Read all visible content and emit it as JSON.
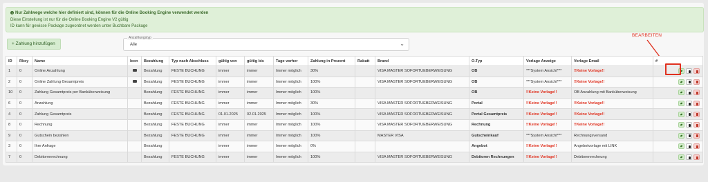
{
  "notice": {
    "line1": "Nur Zahlwege welche hier definiert sind, können für die Online Booking Engine verwendet werden",
    "line2": "Diese Einstellung ist nur für die Online Booking Engine V2 gültig",
    "line3": "ID kann für gewisse Package zugeordnet werden unter Buchbare Package"
  },
  "toolbar": {
    "add_label": "+ Zahlung hinzufügen",
    "select_label": "Anzahlungstyp",
    "select_value": "Alle"
  },
  "annotation": {
    "label": "BEARBEITEN",
    "color": "#e0301e"
  },
  "table": {
    "headers": [
      "ID",
      "Rkey",
      "Name",
      "Icon",
      "Bezahlung",
      "Typ nach Abschluss",
      "gültig von",
      "gültig bis",
      "Tage vorher",
      "Zahlung in Prozent",
      "Rabatt",
      "Brand",
      "O.Typ",
      "Vorlage Anzeige",
      "Vorlage Email",
      "#"
    ],
    "rows": [
      {
        "id": "1",
        "rkey": "0",
        "name": "Online Anzahlung",
        "icon": "bank-icon",
        "bezahlung": "Bezahlung",
        "typ": "FESTE BUCHUNG",
        "von": "immer",
        "bis": "immer",
        "tage": "Immer möglich",
        "prozent": "30%",
        "rabatt": "",
        "brand": "VISA MASTER SOFORTUEBERWEISUNG",
        "otyp": "OB",
        "anzeige": "***System Ansicht***",
        "email": "!!Keine Vorlage!!"
      },
      {
        "id": "2",
        "rkey": "0",
        "name": "Online Zahlung Gesamtpreis",
        "icon": "card-icon",
        "bezahlung": "Bezahlung",
        "typ": "FESTE BUCHUNG",
        "von": "immer",
        "bis": "immer",
        "tage": "Immer möglich",
        "prozent": "100%",
        "rabatt": "",
        "brand": "VISA MASTER SOFORTUEBERWEISUNG",
        "otyp": "OB",
        "anzeige": "***System Ansicht***",
        "email": "!!Keine Vorlage!!"
      },
      {
        "id": "10",
        "rkey": "0",
        "name": "Zahlung Gesamtpreis per Banküberweisung",
        "icon": "",
        "bezahlung": "Bezahlung",
        "typ": "FESTE BUCHUNG",
        "von": "immer",
        "bis": "immer",
        "tage": "Immer möglich",
        "prozent": "100%",
        "rabatt": "",
        "brand": "",
        "otyp": "OB",
        "anzeige": "!!Keine Vorlage!!",
        "email": "OB Anzahlung mit Banküberweisung"
      },
      {
        "id": "6",
        "rkey": "0",
        "name": "Anzahlung",
        "icon": "",
        "bezahlung": "Bezahlung",
        "typ": "FESTE BUCHUNG",
        "von": "immer",
        "bis": "immer",
        "tage": "Immer möglich",
        "prozent": "30%",
        "rabatt": "",
        "brand": "VISA MASTER SOFORTUEBERWEISUNG",
        "otyp": "Portal",
        "anzeige": "!!Keine Vorlage!!",
        "email": "!!Keine Vorlage!!"
      },
      {
        "id": "4",
        "rkey": "0",
        "name": "Zahlung Gesamtpreis",
        "icon": "",
        "bezahlung": "Bezahlung",
        "typ": "FESTE BUCHUNG",
        "von": "01.01.2025",
        "bis": "02.01.2025",
        "tage": "Immer möglich",
        "prozent": "100%",
        "rabatt": "",
        "brand": "VISA MASTER SOFORTUEBERWEISUNG",
        "otyp": "Portal Gesamtpreis",
        "anzeige": "!!Keine Vorlage!!",
        "email": "!!Keine Vorlage!!"
      },
      {
        "id": "8",
        "rkey": "0",
        "name": "Rechnung",
        "icon": "",
        "bezahlung": "Bezahlung",
        "typ": "FESTE BUCHUNG",
        "von": "immer",
        "bis": "immer",
        "tage": "Immer möglich",
        "prozent": "100%",
        "rabatt": "",
        "brand": "VISA MASTER SOFORTUEBERWEISUNG",
        "otyp": "Rechnung",
        "anzeige": "!!Keine Vorlage!!",
        "email": "!!Keine Vorlage!!"
      },
      {
        "id": "9",
        "rkey": "0",
        "name": "Gutschein bezahlen",
        "icon": "",
        "bezahlung": "Bezahlung",
        "typ": "FESTE BUCHUNG",
        "von": "immer",
        "bis": "immer",
        "tage": "Immer möglich",
        "prozent": "100%",
        "rabatt": "",
        "brand": "MASTER VISA",
        "otyp": "Gutscheinkauf",
        "anzeige": "***System Ansicht***",
        "email": "Rechnungsversand"
      },
      {
        "id": "3",
        "rkey": "0",
        "name": "Ihre Anfrage",
        "icon": "",
        "bezahlung": "Bezahlung",
        "typ": "",
        "von": "immer",
        "bis": "immer",
        "tage": "Immer möglich",
        "prozent": "0%",
        "rabatt": "",
        "brand": "",
        "otyp": "Angebot",
        "anzeige": "!!Keine Vorlage!!",
        "email": "Angebotvorlage mit LINK"
      },
      {
        "id": "7",
        "rkey": "0",
        "name": "Debitorenrechnung",
        "icon": "",
        "bezahlung": "Bezahlung",
        "typ": "FESTE BUCHUNG",
        "von": "immer",
        "bis": "immer",
        "tage": "Immer möglich",
        "prozent": "100%",
        "rabatt": "",
        "brand": "VISA MASTER SOFORTUEBERWEISUNG",
        "otyp": "Debitoren Rechnungen",
        "anzeige": "!!Keine Vorlage!!",
        "email": "Debitorenrechnung"
      }
    ]
  }
}
